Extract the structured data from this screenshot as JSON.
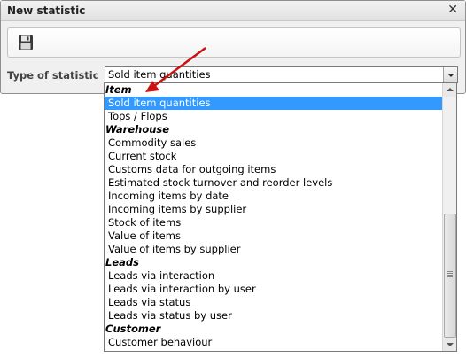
{
  "dialog": {
    "title": "New statistic",
    "close_symbol": "✕",
    "save_icon": "floppy-disk-icon"
  },
  "form": {
    "type_label": "Type of statistic",
    "selected_value": "Sold item quantities"
  },
  "dropdown": {
    "rows": [
      {
        "kind": "group",
        "text": "Item"
      },
      {
        "kind": "option",
        "text": "Sold item quantities",
        "selected": true
      },
      {
        "kind": "option",
        "text": "Tops / Flops"
      },
      {
        "kind": "group",
        "text": "Warehouse"
      },
      {
        "kind": "option",
        "text": "Commodity sales"
      },
      {
        "kind": "option",
        "text": "Current stock"
      },
      {
        "kind": "option",
        "text": "Customs data for outgoing items"
      },
      {
        "kind": "option",
        "text": "Estimated stock turnover and reorder levels"
      },
      {
        "kind": "option",
        "text": "Incoming items by date"
      },
      {
        "kind": "option",
        "text": "Incoming items by supplier"
      },
      {
        "kind": "option",
        "text": "Stock of items"
      },
      {
        "kind": "option",
        "text": "Value of items"
      },
      {
        "kind": "option",
        "text": "Value of items by supplier"
      },
      {
        "kind": "group",
        "text": "Leads"
      },
      {
        "kind": "option",
        "text": "Leads via interaction"
      },
      {
        "kind": "option",
        "text": "Leads via interaction by user"
      },
      {
        "kind": "option",
        "text": "Leads via status"
      },
      {
        "kind": "option",
        "text": "Leads via status by user"
      },
      {
        "kind": "group",
        "text": "Customer"
      },
      {
        "kind": "option",
        "text": "Customer behaviour"
      }
    ]
  },
  "colors": {
    "selection": "#3399ff",
    "annotation_arrow": "#cc1111"
  }
}
